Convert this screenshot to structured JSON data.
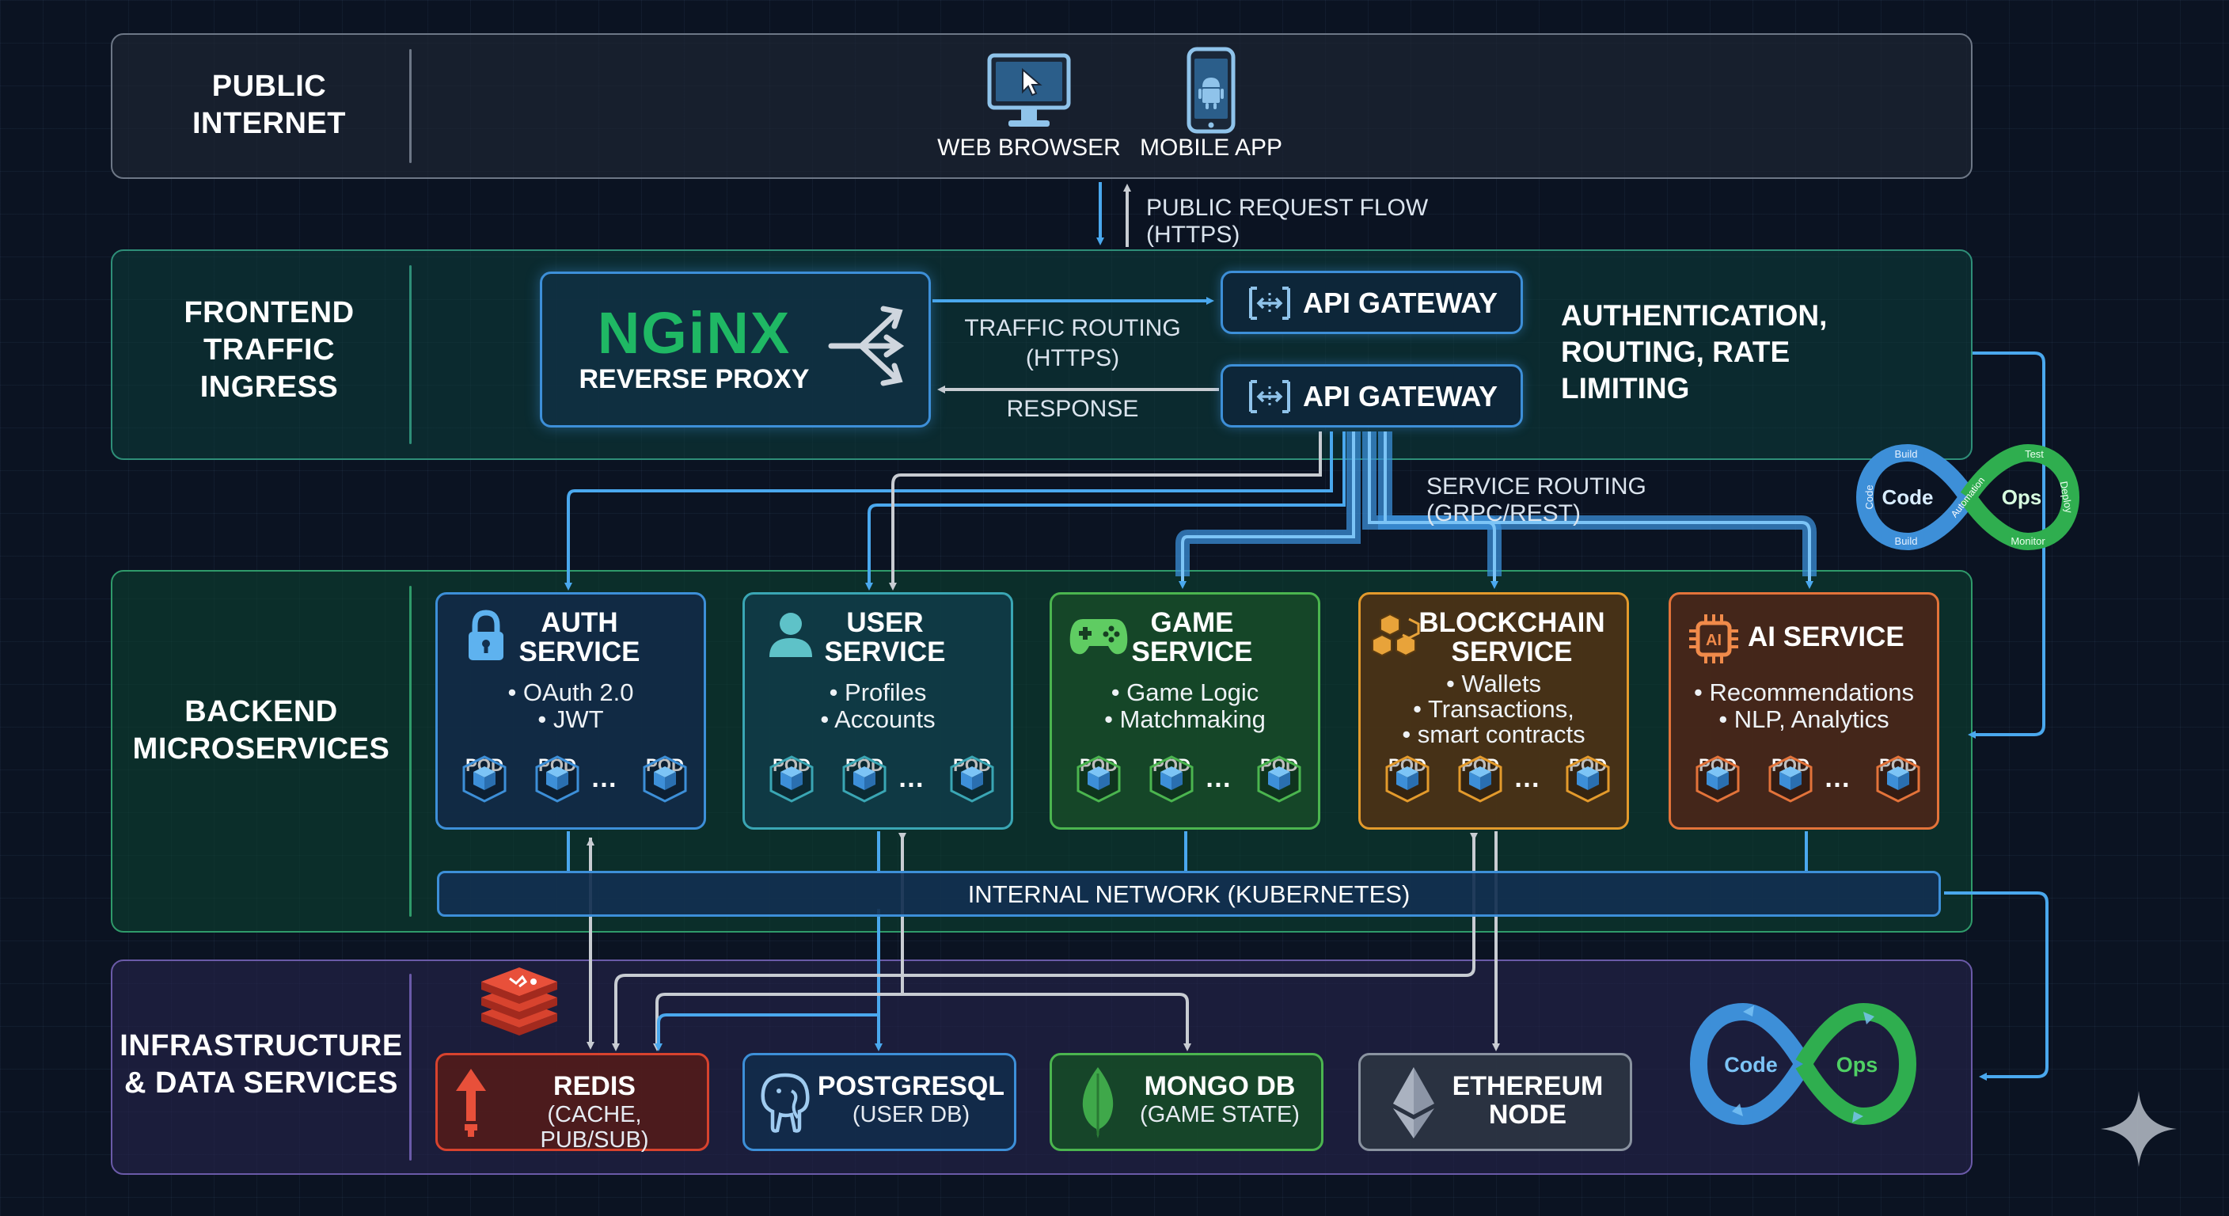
{
  "layers": {
    "public": {
      "label": "PUBLIC\nINTERNET"
    },
    "frontend": {
      "label": "FRONTEND\nTRAFFIC\nINGRESS"
    },
    "backend": {
      "label": "BACKEND\nMICROSERVICES"
    },
    "infra": {
      "label": "INFRASTRUCTURE\n& DATA SERVICES"
    }
  },
  "clients": [
    {
      "label": "WEB BROWSER",
      "icon": "monitor-cursor-icon"
    },
    {
      "label": "MOBILE APP",
      "icon": "android-phone-icon"
    }
  ],
  "flows": {
    "public_request": "PUBLIC REQUEST FLOW (HTTPS)",
    "traffic_routing": "TRAFFIC ROUTING\n(HTTPS)",
    "response": "RESPONSE",
    "service_routing": "SERVICE ROUTING (GRPC/REST)"
  },
  "nginx": {
    "logo": "NGiNX",
    "label": "REVERSE PROXY"
  },
  "gateways": [
    {
      "label": "API GATEWAY"
    },
    {
      "label": "API GATEWAY"
    }
  ],
  "gateway_note": "AUTHENTICATION,\nROUTING, RATE\nLIMITING",
  "services": [
    {
      "title": "AUTH\nSERVICE",
      "bullets": "• OAuth 2.0\n• JWT",
      "icon": "lock-icon",
      "color": "#3d8fd8"
    },
    {
      "title": "USER\nSERVICE",
      "bullets": "• Profiles\n• Accounts",
      "icon": "user-icon",
      "color": "#3aa6b4"
    },
    {
      "title": "GAME\nSERVICE",
      "bullets": "• Game Logic\n• Matchmaking",
      "icon": "gamepad-icon",
      "color": "#4bb54f"
    },
    {
      "title": "BLOCKCHAIN\nSERVICE",
      "bullets": "• Wallets\n• Transactions,\n• smart contracts",
      "icon": "blocks-icon",
      "color": "#e39a2c"
    },
    {
      "title": "AI SERVICE",
      "bullets": "• Recommendations\n• NLP, Analytics",
      "icon": "ai-chip-icon",
      "color": "#e3733a"
    }
  ],
  "pod_label": "POD",
  "pod_ellipsis": "…",
  "internal_network": "INTERNAL NETWORK (KUBERNETES)",
  "datastores": [
    {
      "title": "REDIS",
      "sub": "(CACHE, PUB/SUB)",
      "icon": "redis-icon",
      "color": "#d8432e"
    },
    {
      "title": "POSTGRESQL",
      "sub": "(USER DB)",
      "icon": "postgres-elephant-icon",
      "color": "#3d8fd8"
    },
    {
      "title": "MONGO DB",
      "sub": "(GAME STATE)",
      "icon": "mongodb-leaf-icon",
      "color": "#4bb54f"
    },
    {
      "title": "ETHEREUM\nNODE",
      "sub": "",
      "icon": "ethereum-icon",
      "color": "#8a93a0"
    }
  ],
  "devops_small": {
    "center_left": "Code",
    "center_right": "Ops",
    "stages": [
      "Code",
      "Build",
      "Automation",
      "Test",
      "Deploy",
      "Monitor",
      "Build"
    ]
  },
  "devops_large": {
    "center_left": "Code",
    "center_right": "Ops"
  },
  "colors": {
    "nginx_green": "#1fb864",
    "arrow_blue": "#4aa8ee",
    "arrow_gray": "#c8ccd2"
  }
}
